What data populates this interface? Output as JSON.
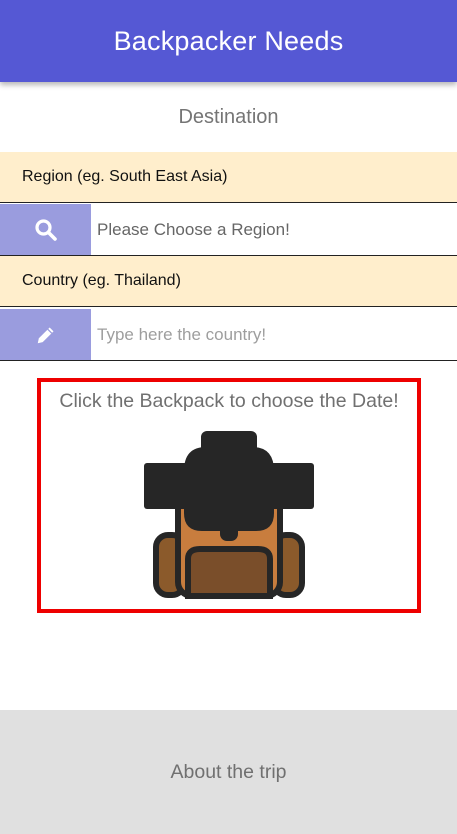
{
  "app_bar": {
    "title": "Backpacker Needs",
    "color": "#5558d4"
  },
  "section": {
    "title": "Destination"
  },
  "region": {
    "label": "Region (eg. South East Asia)",
    "placeholder": "Please Choose a Region!",
    "icon": "search-icon"
  },
  "country": {
    "label": "Country (eg. Thailand)",
    "placeholder": "Type here the country!",
    "icon": "pencil-icon"
  },
  "date_picker": {
    "caption": "Click the Backpack to choose the Date!",
    "icon": "backpack-icon",
    "border_color": "#ee0000"
  },
  "footer": {
    "about_label": "About the trip"
  }
}
